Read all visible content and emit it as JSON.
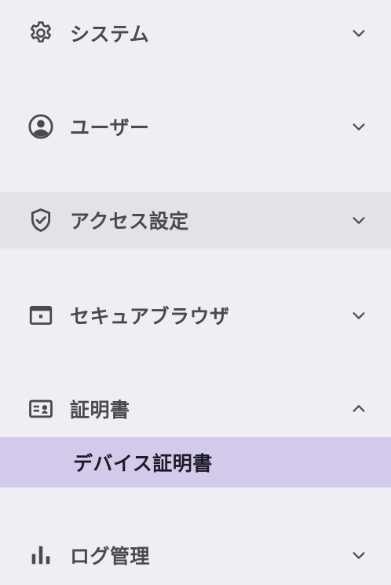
{
  "nav": {
    "items": [
      {
        "label": "システム",
        "icon": "gear-icon",
        "expanded": false
      },
      {
        "label": "ユーザー",
        "icon": "user-circle-icon",
        "expanded": false
      },
      {
        "label": "アクセス設定",
        "icon": "shield-check-icon",
        "expanded": false
      },
      {
        "label": "セキュアブラウザ",
        "icon": "browser-window-icon",
        "expanded": false
      },
      {
        "label": "証明書",
        "icon": "id-card-icon",
        "expanded": true,
        "children": [
          {
            "label": "デバイス証明書",
            "selected": true
          }
        ]
      },
      {
        "label": "ログ管理",
        "icon": "bar-chart-icon",
        "expanded": false
      }
    ]
  },
  "colors": {
    "background": "#efeef4",
    "hover_row": "#e3e2e8",
    "selected_row": "#d4cbec",
    "text": "#4a4950",
    "selected_text": "#1d1b26"
  }
}
